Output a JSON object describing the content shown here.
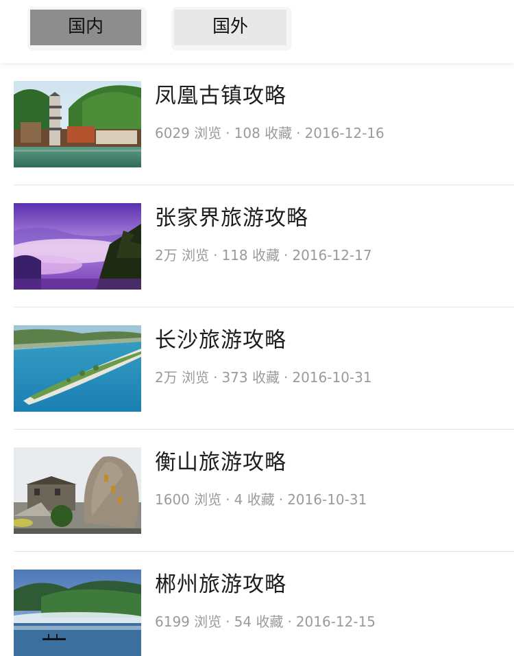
{
  "tabs": [
    {
      "label": "国内",
      "active": true
    },
    {
      "label": "国外",
      "active": false
    }
  ],
  "guides": [
    {
      "title": "凤凰古镇攻略",
      "views": "6029",
      "views_unit": "浏览",
      "favorites": "108",
      "favorites_unit": "收藏",
      "date": "2016-12-16",
      "image": "fenghuang-town-photo"
    },
    {
      "title": "张家界旅游攻略",
      "views": "2万",
      "views_unit": "浏览",
      "favorites": "118",
      "favorites_unit": "收藏",
      "date": "2016-12-17",
      "image": "zhangjiajie-clouds-photo"
    },
    {
      "title": "长沙旅游攻略",
      "views": "2万",
      "views_unit": "浏览",
      "favorites": "373",
      "favorites_unit": "收藏",
      "date": "2016-10-31",
      "image": "changsha-island-photo"
    },
    {
      "title": "衡山旅游攻略",
      "views": "1600",
      "views_unit": "浏览",
      "favorites": "4",
      "favorites_unit": "收藏",
      "date": "2016-10-31",
      "image": "hengshan-rock-photo"
    },
    {
      "title": "郴州旅游攻略",
      "views": "6199",
      "views_unit": "浏览",
      "favorites": "54",
      "favorites_unit": "收藏",
      "date": "2016-12-15",
      "image": "chenzhou-misty-lake-photo"
    }
  ],
  "separator": "·"
}
